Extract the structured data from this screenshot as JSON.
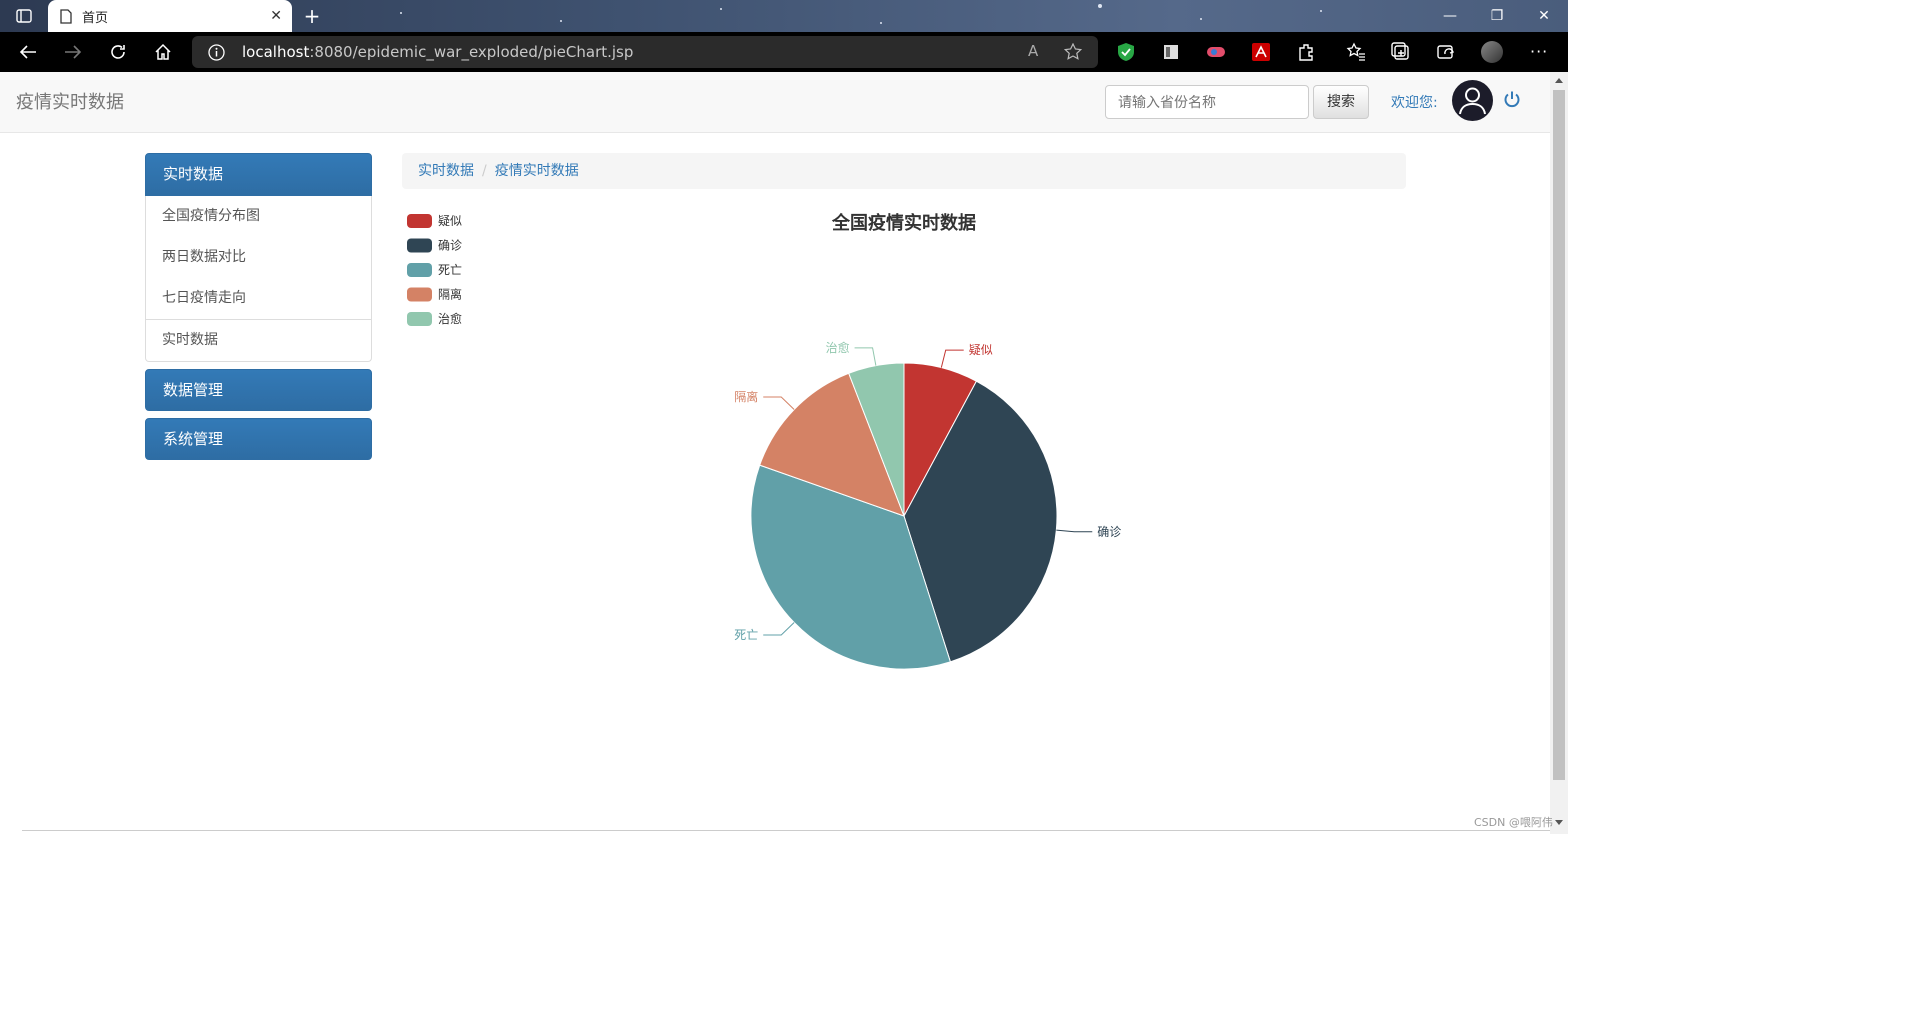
{
  "browser": {
    "tab_title": "首页",
    "url_host": "localhost",
    "url_rest": ":8080/epidemic_war_exploded/pieChart.jsp"
  },
  "navbar": {
    "brand": "疫情实时数据",
    "search_placeholder": "请输入省份名称",
    "search_button": "搜索",
    "welcome": "欢迎您:"
  },
  "sidebar": {
    "groups": [
      {
        "label": "实时数据",
        "items": [
          "全国疫情分布图",
          "两日数据对比",
          "七日疫情走向",
          "实时数据"
        ]
      },
      {
        "label": "数据管理"
      },
      {
        "label": "系统管理"
      }
    ]
  },
  "breadcrumb": [
    "实时数据",
    "疫情实时数据"
  ],
  "chart_data": {
    "type": "pie",
    "title": "全国疫情实时数据",
    "legend_position": "top-left",
    "categories": [
      "疑似",
      "确诊",
      "死亡",
      "隔离",
      "治愈"
    ],
    "values": [
      8,
      38,
      36,
      14,
      6
    ],
    "colors": [
      "#c23531",
      "#2f4554",
      "#61a0a8",
      "#d48265",
      "#91c7ae"
    ]
  },
  "watermark": "CSDN @喂阿伟"
}
